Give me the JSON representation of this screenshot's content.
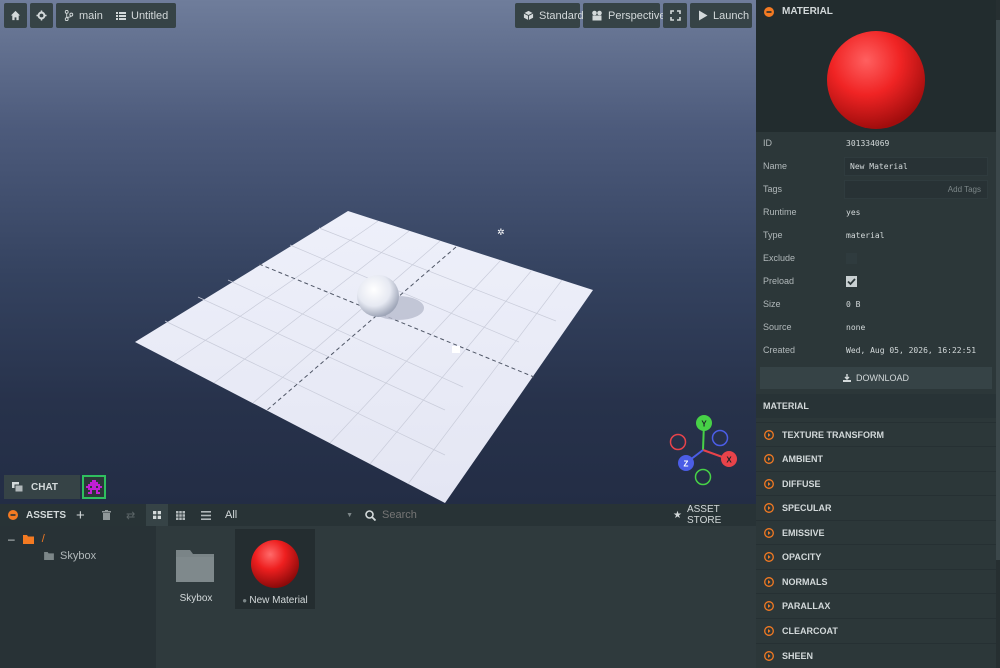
{
  "toolbar": {
    "home_icon": "home-icon",
    "settings_icon": "gear-icon",
    "branch_label": "main",
    "scene_label": "Untitled",
    "standard_label": "Standard",
    "perspective_label": "Perspective",
    "launch_label": "Launch"
  },
  "chat": {
    "label": "CHAT"
  },
  "assets": {
    "title": "ASSETS",
    "filter_value": "All",
    "search_placeholder": "Search",
    "store_label": "ASSET STORE",
    "tree_root": "/",
    "tree_items": [
      "Skybox"
    ],
    "items": [
      {
        "label": "Skybox",
        "type": "folder"
      },
      {
        "label": "New Material",
        "type": "material"
      }
    ]
  },
  "inspector": {
    "title": "MATERIAL",
    "props": {
      "id_label": "ID",
      "id_value": "301334069",
      "name_label": "Name",
      "name_value": "New Material",
      "tags_label": "Tags",
      "tags_placeholder": "Add Tags",
      "runtime_label": "Runtime",
      "runtime_value": "yes",
      "type_label": "Type",
      "type_value": "material",
      "exclude_label": "Exclude",
      "preload_label": "Preload",
      "size_label": "Size",
      "size_value": "0 B",
      "source_label": "Source",
      "source_value": "none",
      "created_label": "Created",
      "created_value": "Wed, Aug 05, 2026, 16:22:51"
    },
    "exclude_checked": false,
    "preload_checked": true,
    "download_label": "DOWNLOAD",
    "material_header": "MATERIAL",
    "sections": [
      "TEXTURE TRANSFORM",
      "AMBIENT",
      "DIFFUSE",
      "SPECULAR",
      "EMISSIVE",
      "OPACITY",
      "NORMALS",
      "PARALLAX",
      "CLEARCOAT",
      "SHEEN"
    ]
  },
  "gizmo": {
    "x_label": "X",
    "y_label": "Y",
    "z_label": "Z"
  },
  "colors": {
    "accent": "#f47a22",
    "material_red": "#ff2a2a",
    "gizmo_x": "#e8434a",
    "gizmo_y": "#47d147",
    "gizmo_z": "#4b5de6"
  }
}
